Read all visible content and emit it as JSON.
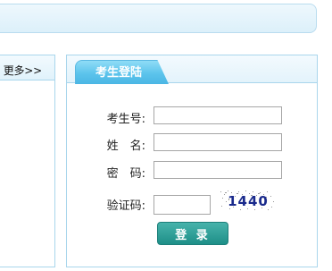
{
  "sidebar": {
    "more_link": "更多>>"
  },
  "login": {
    "tab_title": "考生登陆",
    "fields": {
      "exam_id_label": "考生号:",
      "name_label": "姓　名:",
      "password_label": "密　码:",
      "captcha_label": "验证码:"
    },
    "captcha_text": "1440",
    "submit_label": "登 录"
  }
}
